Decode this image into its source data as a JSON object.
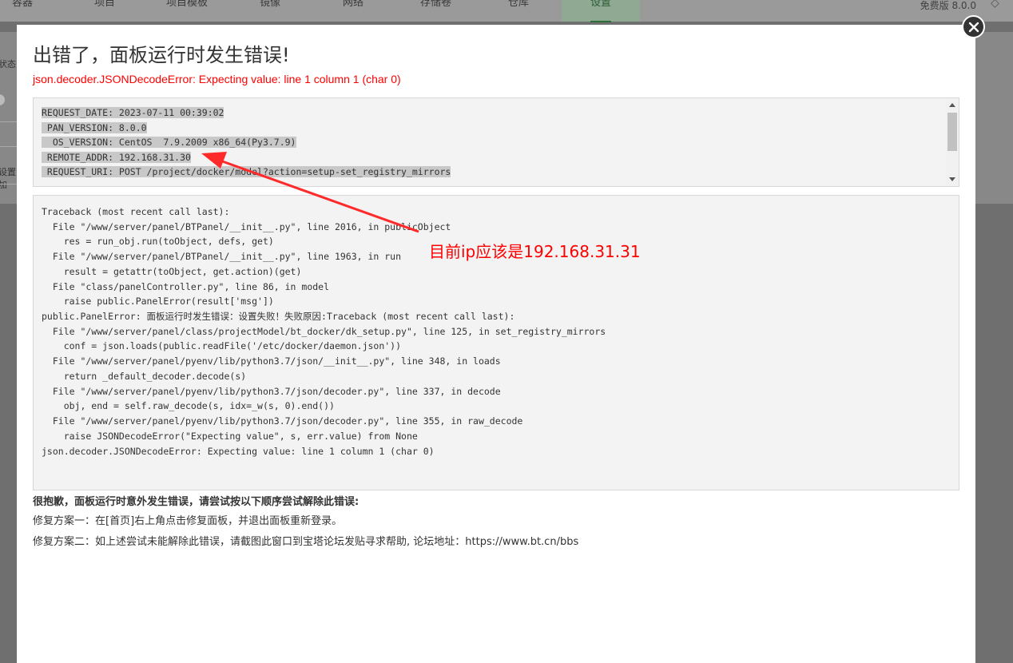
{
  "nav": {
    "tabs": [
      "容器",
      "项目",
      "项目模板",
      "镜像",
      "网络",
      "存储卷",
      "仓库",
      "设置"
    ],
    "active": "设置",
    "version": "免费版  8.0.0"
  },
  "background": {
    "left_labels": [
      "状态",
      "设置加"
    ]
  },
  "modal": {
    "title": "出错了，面板运行时发生错误!",
    "subtitle": "json.decoder.JSONDecodeError: Expecting value: line 1 column 1 (char 0)",
    "request_lines": [
      "REQUEST_DATE: 2023-07-11 00:39:02",
      " PAN_VERSION: 8.0.0",
      "  OS_VERSION: CentOS  7.9.2009 x86_64(Py3.7.9)",
      " REMOTE_ADDR: 192.168.31.30",
      " REQUEST_URI: POST /project/docker/model?action=setup-set_registry_mirrors"
    ],
    "traceback_lines": [
      "Traceback (most recent call last):",
      "  File \"/www/server/panel/BTPanel/__init__.py\", line 2016, in publicObject",
      "    res = run_obj.run(toObject, defs, get)",
      "  File \"/www/server/panel/BTPanel/__init__.py\", line 1963, in run",
      "    result = getattr(toObject, get.action)(get)",
      "  File \"class/panelController.py\", line 86, in model",
      "    raise public.PanelError(result['msg'])",
      "public.PanelError: 面板运行时发生错误：设置失败！失败原因:Traceback (most recent call last):",
      "  File \"/www/server/panel/class/projectModel/bt_docker/dk_setup.py\", line 125, in set_registry_mirrors",
      "    conf = json.loads(public.readFile('/etc/docker/daemon.json'))",
      "  File \"/www/server/panel/pyenv/lib/python3.7/json/__init__.py\", line 348, in loads",
      "    return _default_decoder.decode(s)",
      "  File \"/www/server/panel/pyenv/lib/python3.7/json/decoder.py\", line 337, in decode",
      "    obj, end = self.raw_decode(s, idx=_w(s, 0).end())",
      "  File \"/www/server/panel/pyenv/lib/python3.7/json/decoder.py\", line 355, in raw_decode",
      "    raise JSONDecodeError(\"Expecting value\", s, err.value) from None",
      "json.decoder.JSONDecodeError: Expecting value: line 1 column 1 (char 0)"
    ],
    "help_title": "很抱歉，面板运行时意外发生错误，请尝试按以下顺序尝试解除此错误:",
    "help_line1": "修复方案一：在[首页]右上角点击修复面板，并退出面板重新登录。",
    "help_line2": "修复方案二：如上述尝试未能解除此错误，请截图此窗口到宝塔论坛发贴寻求帮助, 论坛地址：https://www.bt.cn/bbs"
  },
  "annotation": {
    "text": "目前ip应该是192.168.31.31",
    "color": "#ff0000"
  },
  "icons": {
    "close": "close-icon",
    "gem": "diamond-icon"
  }
}
